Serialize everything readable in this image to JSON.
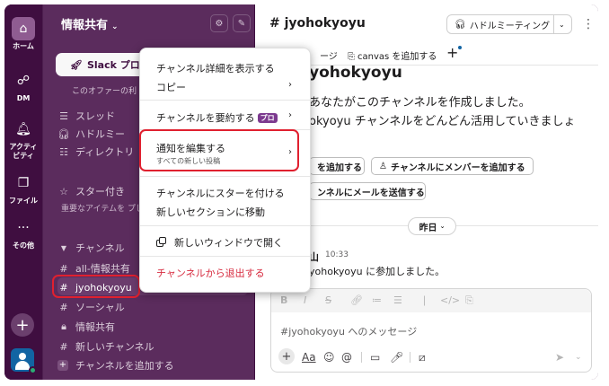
{
  "rail": {
    "items": [
      {
        "label": "ホーム",
        "icon": "home-icon",
        "glyph": "⌂"
      },
      {
        "label": "DM",
        "icon": "dm-icon",
        "glyph": "☍"
      },
      {
        "label_line1": "アクティ",
        "label_line2": "ビティ",
        "icon": "bell-icon",
        "glyph": "🔔︎"
      },
      {
        "label": "ファイル",
        "icon": "files-icon",
        "glyph": "❐"
      },
      {
        "label": "その他",
        "icon": "more-icon",
        "glyph": "···"
      }
    ],
    "add_glyph": "+"
  },
  "sidebar": {
    "workspace_name": "情報共有",
    "workspace_chevron": "⌄",
    "settings_glyph": "⚙",
    "compose_glyph": "✎",
    "promo_button": "Slack プロ",
    "promo_subtext": "このオファーの利",
    "nav": [
      {
        "glyph": "☰",
        "label": "スレッド"
      },
      {
        "glyph": "🎧︎",
        "label": "ハドルミー"
      },
      {
        "glyph": "☷",
        "label": "ディレクトリ"
      }
    ],
    "starred_header": "スター付き",
    "starred_desc": "重要なアイテムを プします",
    "channels_header": "チャンネル",
    "channels": [
      {
        "glyph": "#",
        "label": "all-情報共有"
      },
      {
        "glyph": "#",
        "label": "jyohokyoyu"
      },
      {
        "glyph": "#",
        "label": "ソーシャル"
      },
      {
        "glyph": "🔒︎",
        "label": "情報共有"
      },
      {
        "glyph": "#",
        "label": "新しいチャンネル"
      }
    ],
    "add_channel": "チャンネルを追加する"
  },
  "header": {
    "channel_title": "# jyohokyoyu",
    "huddle_label": "ハドルミーティング",
    "huddle_glyph": "🎧︎",
    "more_glyph": "⋮",
    "tabs": [
      {
        "label": "ージ"
      },
      {
        "label": "canvas を追加する"
      }
    ],
    "tab_add_glyph": "+"
  },
  "main": {
    "big_title": "yohokyoyu",
    "intro_line1": "あなたがこのチャンネルを作成しました。",
    "intro_line2": "okyoyu チャンネルをどんどん活用していきましょ",
    "action_buttons": [
      {
        "label": "を追加する"
      },
      {
        "label": "チャンネルにメンバーを追加する"
      },
      {
        "label": "ンネルにメールを送信する"
      }
    ],
    "date_pill": "昨日",
    "message": {
      "name": "山",
      "time": "10:33",
      "text": "yohokyoyu に参加しました。"
    },
    "composer_placeholder": "#jyohokyoyu へのメッセージ",
    "format_glyphs": [
      "B",
      "I",
      "S",
      "🔗︎",
      "≔",
      "☰",
      "❘",
      "</>",
      "⎘"
    ],
    "composer_tools": [
      "Aa",
      "☺",
      "@",
      "▭",
      "🎤︎",
      "⧄"
    ]
  },
  "menu": {
    "items": {
      "details": "チャンネル詳細を表示する",
      "copy": "コピー",
      "summarize": "チャンネルを要約する",
      "pro_badge": "プロ",
      "notifications": "通知を編集する",
      "notifications_sub": "すべての新しい投稿",
      "star": "チャンネルにスターを付ける",
      "move": "新しいセクションに移動",
      "new_window": "新しいウィンドウで開く",
      "leave": "チャンネルから退出する"
    },
    "arrow": "›"
  },
  "colors": {
    "rail": "#3f0e40",
    "sidebar": "#5b2c5d",
    "highlight": "#e0202f",
    "leave": "#d72b3f"
  }
}
